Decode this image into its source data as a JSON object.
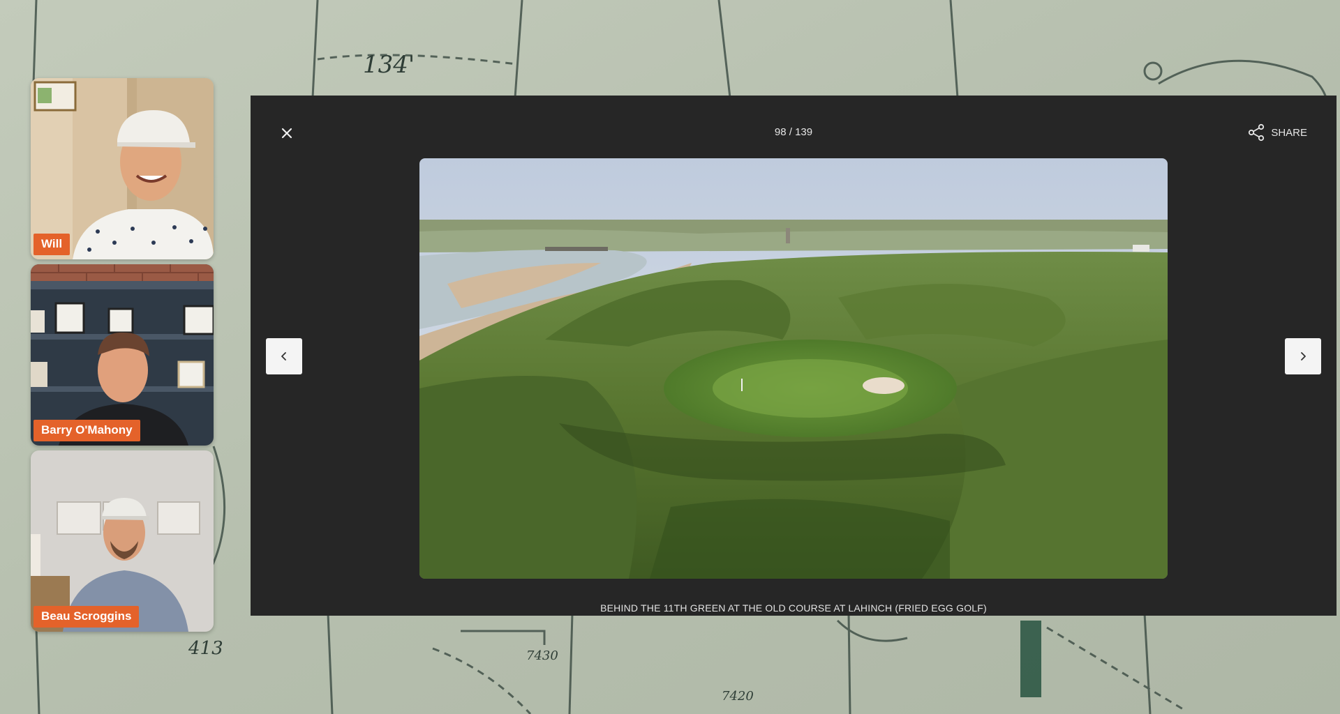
{
  "participants": [
    {
      "name": "Will"
    },
    {
      "name": "Barry O'Mahony"
    },
    {
      "name": "Beau Scroggins"
    }
  ],
  "lightbox": {
    "counter": "98 / 139",
    "share_label": "SHARE",
    "caption": "BEHIND THE 11TH GREEN AT THE OLD COURSE AT LAHINCH (FRIED EGG GOLF)",
    "icons": {
      "close": "close-icon",
      "share": "share-icon",
      "prev": "chevron-left-icon",
      "next": "chevron-right-icon"
    }
  },
  "background": {
    "map_labels": [
      "134'",
      "7430",
      "7420",
      "413"
    ]
  },
  "colors": {
    "name_tag": "#e4622a",
    "lightbox_bg": "#262626",
    "nav_button_bg": "#f4f4f4"
  }
}
